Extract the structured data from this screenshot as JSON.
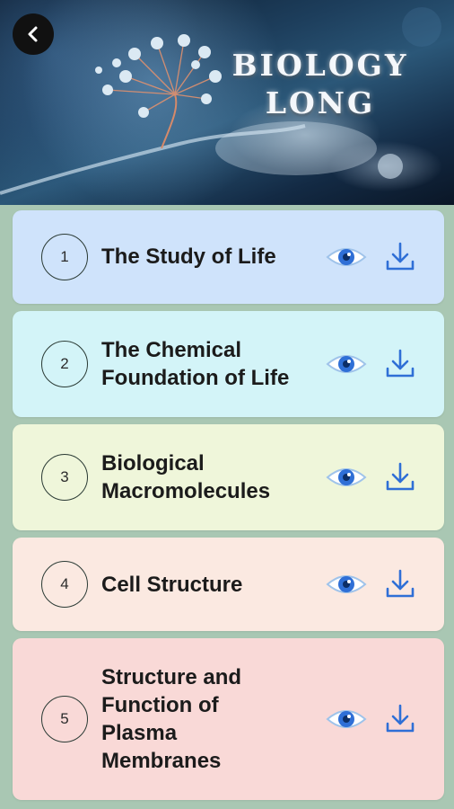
{
  "header": {
    "title_line1": "BIOLOGY",
    "title_line2": "LONG",
    "back_icon": "chevron-left-icon"
  },
  "chapters": [
    {
      "number": "1",
      "title": "The Study of Life",
      "color": "#cfe3fb",
      "view_icon": "eye-icon",
      "download_icon": "download-icon"
    },
    {
      "number": "2",
      "title": "The Chemical Foundation of Life",
      "color": "#d3f4f8",
      "view_icon": "eye-icon",
      "download_icon": "download-icon"
    },
    {
      "number": "3",
      "title": "Biological Macromolecules",
      "color": "#eff6da",
      "view_icon": "eye-icon",
      "download_icon": "download-icon"
    },
    {
      "number": "4",
      "title": "Cell Structure",
      "color": "#fbe9e1",
      "view_icon": "eye-icon",
      "download_icon": "download-icon"
    },
    {
      "number": "5",
      "title": "Structure and Function of Plasma Membranes",
      "color": "#f9d9d7",
      "view_icon": "eye-icon",
      "download_icon": "download-icon"
    }
  ],
  "accent_color": "#2f6fd6"
}
